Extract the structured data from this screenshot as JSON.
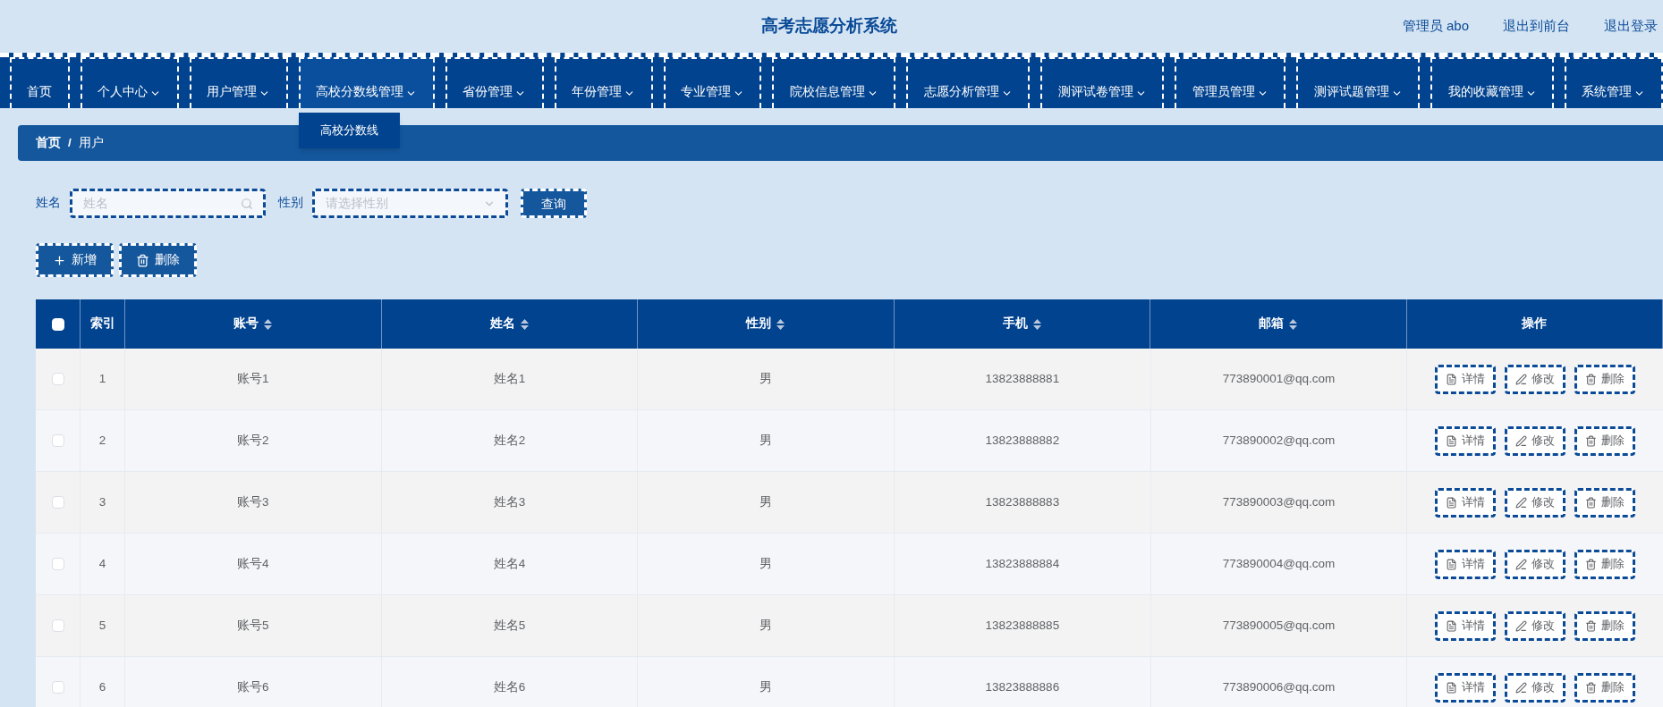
{
  "header": {
    "title": "高考志愿分析系统",
    "links": [
      "管理员 abo",
      "退出到前台",
      "退出登录"
    ]
  },
  "nav": [
    {
      "label": "首页",
      "kind": "link",
      "expanded": false
    },
    {
      "label": "个人中心",
      "kind": "menu",
      "expanded": false
    },
    {
      "label": "用户管理",
      "kind": "menu",
      "expanded": false
    },
    {
      "label": "高校分数线管理",
      "kind": "menu",
      "expanded": true,
      "children": [
        "高校分数线"
      ]
    },
    {
      "label": "省份管理",
      "kind": "menu",
      "expanded": false
    },
    {
      "label": "年份管理",
      "kind": "menu",
      "expanded": false
    },
    {
      "label": "专业管理",
      "kind": "menu",
      "expanded": false
    },
    {
      "label": "院校信息管理",
      "kind": "menu",
      "expanded": false
    },
    {
      "label": "志愿分析管理",
      "kind": "menu",
      "expanded": false
    },
    {
      "label": "测评试卷管理",
      "kind": "menu",
      "expanded": false
    },
    {
      "label": "管理员管理",
      "kind": "menu",
      "expanded": false
    },
    {
      "label": "测评试题管理",
      "kind": "menu",
      "expanded": false
    },
    {
      "label": "我的收藏管理",
      "kind": "menu",
      "expanded": false
    },
    {
      "label": "系统管理",
      "kind": "menu",
      "expanded": false
    }
  ],
  "breadcrumb": [
    "首页",
    "/",
    "用户"
  ],
  "filters": [
    {
      "label": "姓名",
      "kind": "text",
      "placeholder": "姓名"
    },
    {
      "label": "性别",
      "kind": "select",
      "placeholder": "请选择性别"
    }
  ],
  "search_button": "查询",
  "actions": [
    {
      "label": "新增",
      "kind": "add"
    },
    {
      "label": "删除",
      "kind": "delete"
    }
  ],
  "table": {
    "select_all_checked": false,
    "columns": [
      {
        "label": "索引",
        "sortable": false
      },
      {
        "label": "账号",
        "sortable": true
      },
      {
        "label": "姓名",
        "sortable": true
      },
      {
        "label": "性别",
        "sortable": true
      },
      {
        "label": "手机",
        "sortable": true
      },
      {
        "label": "邮箱",
        "sortable": true
      },
      {
        "label": "操作",
        "sortable": false
      }
    ],
    "rows": [
      {
        "checked": false,
        "cells": [
          "1",
          "账号1",
          "姓名1",
          "男",
          "13823888881",
          "773890001@qq.com"
        ],
        "actions": [
          {
            "label": "详情",
            "kind": "detail"
          },
          {
            "label": "修改",
            "kind": "edit"
          },
          {
            "label": "删除",
            "kind": "delete"
          }
        ]
      },
      {
        "checked": false,
        "cells": [
          "2",
          "账号2",
          "姓名2",
          "男",
          "13823888882",
          "773890002@qq.com"
        ],
        "actions": [
          {
            "label": "详情",
            "kind": "detail"
          },
          {
            "label": "修改",
            "kind": "edit"
          },
          {
            "label": "删除",
            "kind": "delete"
          }
        ]
      },
      {
        "checked": false,
        "cells": [
          "3",
          "账号3",
          "姓名3",
          "男",
          "13823888883",
          "773890003@qq.com"
        ],
        "actions": [
          {
            "label": "详情",
            "kind": "detail"
          },
          {
            "label": "修改",
            "kind": "edit"
          },
          {
            "label": "删除",
            "kind": "delete"
          }
        ]
      },
      {
        "checked": false,
        "cells": [
          "4",
          "账号4",
          "姓名4",
          "男",
          "13823888884",
          "773890004@qq.com"
        ],
        "actions": [
          {
            "label": "详情",
            "kind": "detail"
          },
          {
            "label": "修改",
            "kind": "edit"
          },
          {
            "label": "删除",
            "kind": "delete"
          }
        ]
      },
      {
        "checked": false,
        "cells": [
          "5",
          "账号5",
          "姓名5",
          "男",
          "13823888885",
          "773890005@qq.com"
        ],
        "actions": [
          {
            "label": "详情",
            "kind": "detail"
          },
          {
            "label": "修改",
            "kind": "edit"
          },
          {
            "label": "删除",
            "kind": "delete"
          }
        ]
      },
      {
        "checked": false,
        "cells": [
          "6",
          "账号6",
          "姓名6",
          "男",
          "13823888886",
          "773890006@qq.com"
        ],
        "actions": [
          {
            "label": "详情",
            "kind": "detail"
          },
          {
            "label": "修改",
            "kind": "edit"
          },
          {
            "label": "删除",
            "kind": "delete"
          }
        ]
      }
    ]
  }
}
